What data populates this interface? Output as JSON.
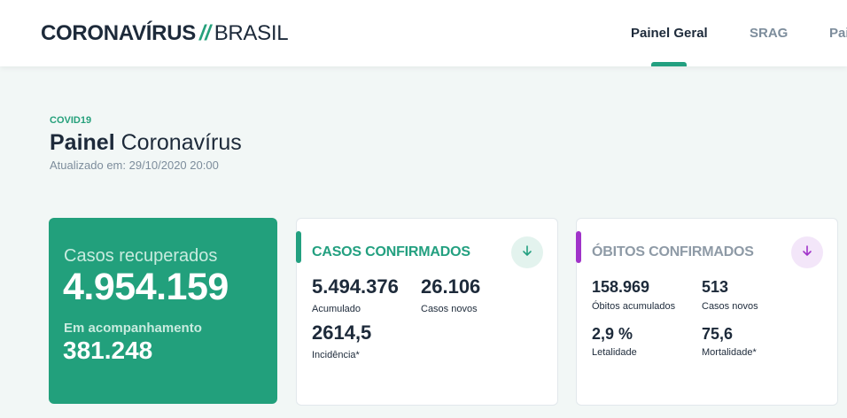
{
  "header": {
    "logo_bold": "CORONAVÍRUS",
    "logo_slash": "//",
    "logo_light": "BRASIL",
    "tabs": [
      {
        "label": "Painel Geral",
        "active": true
      },
      {
        "label": "SRAG",
        "active": false
      },
      {
        "label": "Pai",
        "active": false
      }
    ]
  },
  "page": {
    "kicker": "COVID19",
    "title_bold": "Painel",
    "title_rest": "Coronavírus",
    "updated": "Atualizado em: 29/10/2020 20:00"
  },
  "recovered_card": {
    "label": "Casos recuperados",
    "value": "4.954.159",
    "sub_label": "Em acompanhamento",
    "sub_value": "381.248",
    "color": "#22a07c"
  },
  "confirmed_card": {
    "title": "CASOS CONFIRMADOS",
    "accent": "#23a080",
    "icon": "arrow-down-icon",
    "metrics": [
      {
        "value": "5.494.376",
        "label": "Acumulado"
      },
      {
        "value": "26.106",
        "label": "Casos novos"
      },
      {
        "value": "2614,5",
        "label": "Incidência*"
      }
    ]
  },
  "deaths_card": {
    "title": "ÓBITOS CONFIRMADOS",
    "accent": "#a033c9",
    "icon": "arrow-down-icon",
    "metrics": [
      {
        "value": "158.969",
        "label": "Óbitos acumulados"
      },
      {
        "value": "513",
        "label": "Casos novos"
      },
      {
        "value": "2,9 %",
        "label": "Letalidade"
      },
      {
        "value": "75,6",
        "label": "Mortalidade*"
      }
    ]
  }
}
